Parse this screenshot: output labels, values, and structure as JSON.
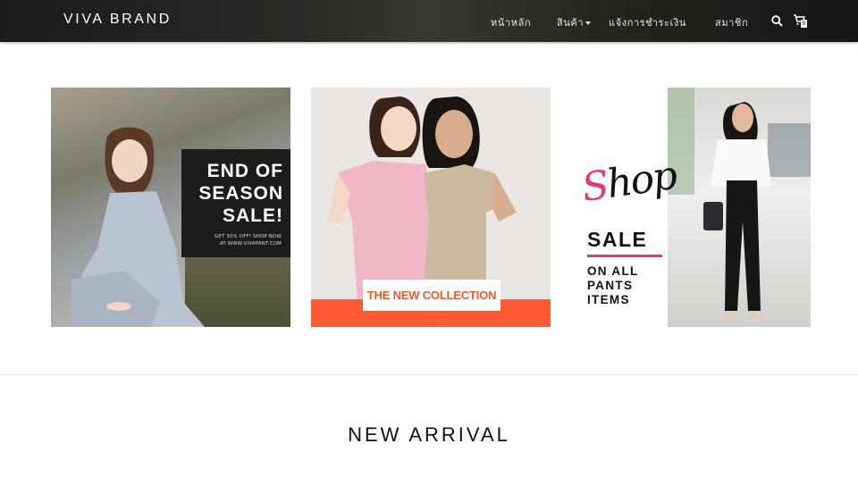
{
  "header": {
    "brand": "VIVA BRAND",
    "nav": [
      {
        "label": "หน้าหลัก"
      },
      {
        "label": "สินค้า"
      },
      {
        "label": "แจ้งการชำระเงิน"
      },
      {
        "label": "สมาชิก"
      }
    ],
    "cart_count": "0",
    "icons": [
      "search-icon",
      "cart-icon"
    ]
  },
  "banners": [
    {
      "headline": [
        "END OF",
        "SEASON",
        "SALE!"
      ],
      "small_lines": [
        "GET 30% OFF! SHOP NOW",
        "AT WWW.VIVAPANT.COM"
      ]
    },
    {
      "label": "THE NEW COLLECTION !!"
    },
    {
      "script_first": "S",
      "script_rest": "hop",
      "sale": "SALE",
      "sub_lines": [
        "ON ALL",
        "PANTS",
        "ITEMS"
      ]
    }
  ],
  "section": {
    "title": "NEW ARRIVAL"
  },
  "colors": {
    "accent_orange": "#ff5a36",
    "accent_pink": "#e8367d",
    "dark": "#1c1c1c"
  }
}
